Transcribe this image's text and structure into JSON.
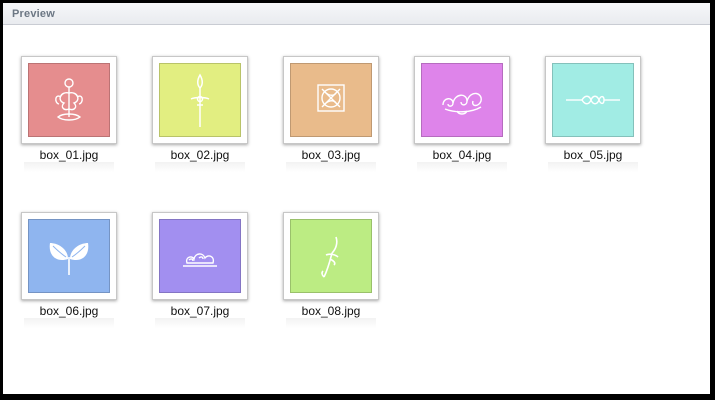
{
  "panel": {
    "title": "Preview"
  },
  "thumbnails": [
    {
      "filename": "box_01.jpg",
      "color": "#e58d8e",
      "icon": "fleur-ornament-icon"
    },
    {
      "filename": "box_02.jpg",
      "color": "#e2ee81",
      "icon": "sword-ornament-icon"
    },
    {
      "filename": "box_03.jpg",
      "color": "#e9bb8b",
      "icon": "square-knot-ornament-icon"
    },
    {
      "filename": "box_04.jpg",
      "color": "#de84ea",
      "icon": "swirl-ornament-icon"
    },
    {
      "filename": "box_05.jpg",
      "color": "#a1ece4",
      "icon": "rope-divider-icon"
    },
    {
      "filename": "box_06.jpg",
      "color": "#8fb5ef",
      "icon": "leaves-icon"
    },
    {
      "filename": "box_07.jpg",
      "color": "#a28ff0",
      "icon": "cloud-ornament-icon"
    },
    {
      "filename": "box_08.jpg",
      "color": "#bcec83",
      "icon": "dagger-ornament-icon"
    }
  ]
}
